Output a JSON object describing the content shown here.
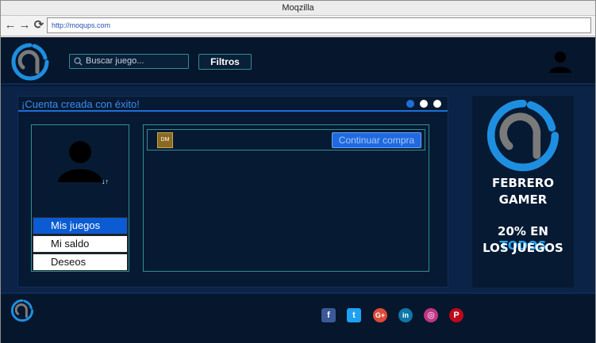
{
  "browser": {
    "title": "Moqzilla",
    "url": "http://moqups.com"
  },
  "header": {
    "search_placeholder": "Buscar juego...",
    "filters_label": "Filtros"
  },
  "panel": {
    "title": "¡Cuenta creada con éxito!",
    "carousel_dots": [
      "#1e6fd6",
      "#ffffff",
      "#ffffff"
    ]
  },
  "profile": {
    "sort_label": "↓↑",
    "menu": [
      {
        "label": "Mis juegos",
        "active": true
      },
      {
        "label": "Mi saldo",
        "active": false
      },
      {
        "label": "Deseos",
        "active": false
      }
    ]
  },
  "games": {
    "thumb_label": "DM",
    "continue_label": "Continuar compra"
  },
  "ad": {
    "line1": "FEBRERO",
    "line2": "GAMER",
    "line3_prefix": "20% EN ",
    "line3_highlight": "TODOS",
    "line4": "LOS JUEGOS"
  },
  "footer": {
    "social": [
      {
        "name": "facebook-icon",
        "glyph": "f",
        "color": "#3b5998"
      },
      {
        "name": "twitter-icon",
        "glyph": "t",
        "color": "#1da1f2"
      },
      {
        "name": "google-plus-icon",
        "glyph": "G+",
        "color": "#dd4b39"
      },
      {
        "name": "linkedin-icon",
        "glyph": "in",
        "color": "#0e76a8"
      },
      {
        "name": "instagram-icon",
        "glyph": "◎",
        "color": "#c13584"
      },
      {
        "name": "pinterest-icon",
        "glyph": "P",
        "color": "#bd081c"
      }
    ]
  },
  "colors": {
    "accent": "#1e6fd6",
    "app_bg": "#071a33",
    "border_teal": "#2f8f8f"
  }
}
